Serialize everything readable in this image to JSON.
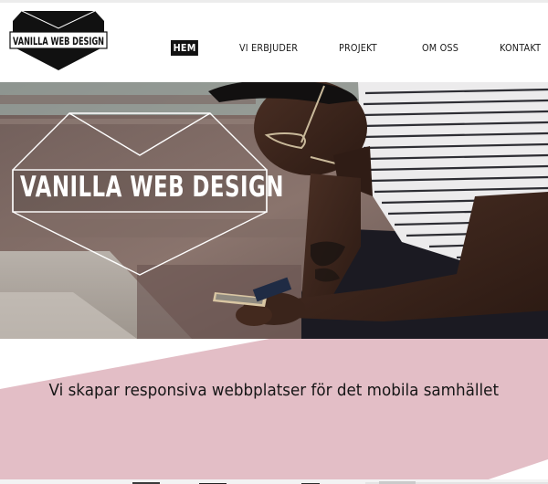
{
  "brand": {
    "logo_text": "VANILLA WEB DESIGN"
  },
  "nav": {
    "items": [
      {
        "label": "HEM",
        "active": true
      },
      {
        "label": "VI ERBJUDER",
        "active": false
      },
      {
        "label": "PROJEKT",
        "active": false
      },
      {
        "label": "OM OSS",
        "active": false
      },
      {
        "label": "KONTAKT",
        "active": false
      }
    ]
  },
  "hero": {
    "logo_text": "VANILLA WEB DESIGN",
    "image_subject": "man-with-phone"
  },
  "tagline": "Vi skapar responsiva webbplatser för det mobila samhället",
  "colors": {
    "pink": "#e3bec6",
    "dark": "#111111",
    "white": "#ffffff"
  }
}
